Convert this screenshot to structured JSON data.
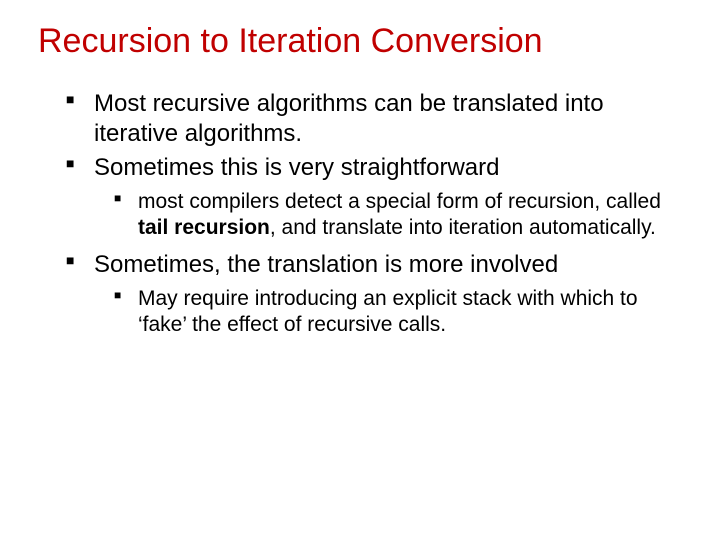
{
  "title": "Recursion to Iteration Conversion",
  "bullets": {
    "b1": "Most recursive algorithms can be translated into iterative algorithms.",
    "b2": "Sometimes this is very straightforward",
    "b2_1_a": "most compilers detect a special form of recursion, called ",
    "b2_1_bold": "tail recursion",
    "b2_1_b": ", and translate into iteration automatically.",
    "b3": "Sometimes, the translation is more involved",
    "b3_1": "May require introducing an explicit stack with which to ‘fake’ the effect of recursive calls."
  }
}
